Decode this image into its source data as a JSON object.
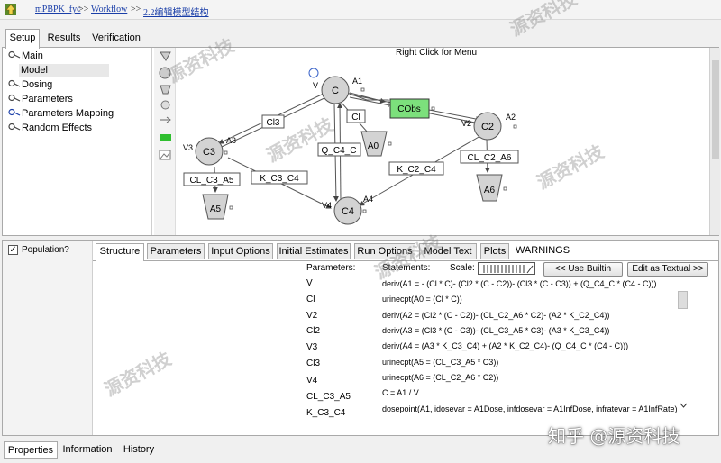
{
  "breadcrumb": {
    "items": [
      "mPBPK_fyc",
      "Workflow",
      "2.2编辑模型结构"
    ],
    "separator": ">>"
  },
  "tabs": [
    "Setup",
    "Results",
    "Verification"
  ],
  "tree": {
    "items": [
      {
        "label": "Main",
        "icon": "link-icon"
      },
      {
        "label": "Model",
        "icon": ""
      },
      {
        "label": "Dosing",
        "icon": "link-icon"
      },
      {
        "label": "Parameters",
        "icon": "link-icon"
      },
      {
        "label": "Parameters Mapping",
        "icon": "link-icon"
      },
      {
        "label": "Random Effects",
        "icon": "link-icon"
      }
    ]
  },
  "palette": [
    "funnel-icon",
    "compartment-icon",
    "elimination-icon",
    "small-compartment-icon",
    "arrow-icon",
    "green-block-icon",
    "image-icon"
  ],
  "canvas": {
    "hint": "Right Click for Menu",
    "nodes": {
      "C": "C",
      "A1": "A1",
      "V": "V",
      "C2": "C2",
      "A2": "A2",
      "V2": "V2",
      "C3": "C3",
      "A3": "A3",
      "V3": "V3",
      "C4": "C4",
      "A4": "A4",
      "V4": "V4",
      "A0": "A0",
      "A5": "A5",
      "A6": "A6",
      "Cobs": "CObs"
    },
    "flows": [
      "Cl3",
      "Cl",
      "Q_C4_C",
      "K_C2_C4",
      "CL_C2_A6",
      "CL_C3_A5",
      "K_C3_C4"
    ]
  },
  "population": {
    "label": "Population?",
    "checked": true
  },
  "subtabs": [
    "Structure",
    "Parameters",
    "Input Options",
    "Initial Estimates",
    "Run Options",
    "Model Text",
    "Plots",
    "WARNINGS"
  ],
  "structure": {
    "parameters_header": "Parameters:",
    "statements_header": "Statements:",
    "scale_label": "Scale:",
    "use_builtin": "<< Use Builtin",
    "edit_textual": "Edit as Textual >>",
    "parameters": [
      "V",
      "Cl",
      "V2",
      "Cl2",
      "V3",
      "Cl3",
      "V4",
      "CL_C3_A5",
      "K_C3_C4"
    ],
    "statements": [
      "deriv(A1 = - (Cl * C)- (Cl2 * (C - C2))- (Cl3 * (C - C3)) + (Q_C4_C * (C4 - C)))",
      "urinecpt(A0 = (Cl * C))",
      "deriv(A2 = (Cl2 * (C - C2))- (CL_C2_A6 * C2)- (A2 * K_C2_C4))",
      "deriv(A3 = (Cl3 * (C - C3))- (CL_C3_A5 * C3)- (A3 * K_C3_C4))",
      "deriv(A4 = (A3 * K_C3_C4) + (A2 * K_C2_C4)- (Q_C4_C * (C4 - C)))",
      "urinecpt(A5 = (CL_C3_A5 * C3))",
      "urinecpt(A6 = (CL_C2_A6 * C2))",
      "C = A1 / V",
      "dosepoint(A1, idosevar = A1Dose, infdosevar = A1InfDose, infratevar = A1InfRate)"
    ]
  },
  "bottom_tabs": [
    "Properties",
    "Information",
    "History"
  ],
  "watermark": "源资科技",
  "brand": "知乎 @源资科技",
  "colors": {
    "node_fill": "#d3d3d3",
    "cobs_fill": "#7ce07c",
    "link": "#1a3ea8"
  }
}
